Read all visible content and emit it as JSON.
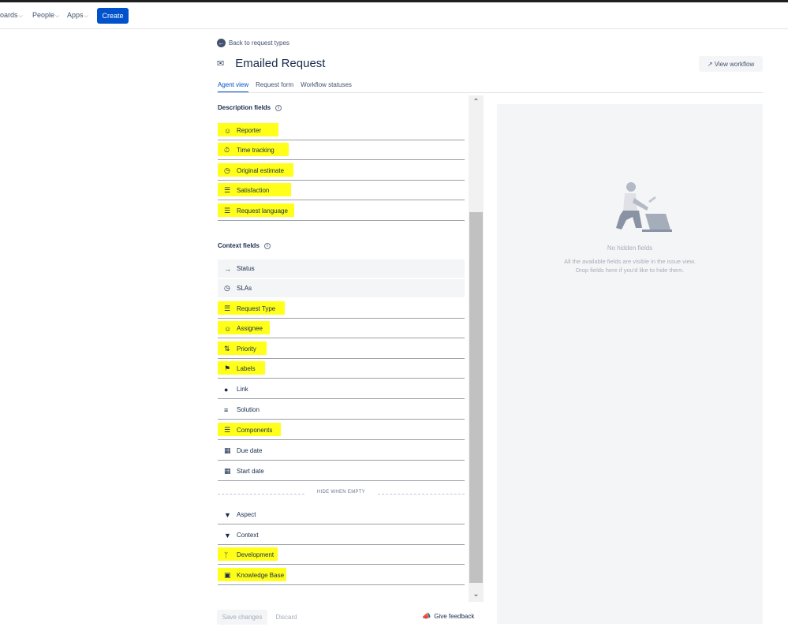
{
  "topnav": {
    "items": [
      {
        "label": "oards"
      },
      {
        "label": "People"
      },
      {
        "label": "Apps"
      }
    ],
    "create_label": "Create"
  },
  "back_link": "Back to request types",
  "page_title": "Emailed Request",
  "view_workflow_label": "View workflow",
  "tabs": [
    {
      "label": "Agent view",
      "active": true
    },
    {
      "label": "Request form",
      "active": false
    },
    {
      "label": "Workflow statuses",
      "active": false
    }
  ],
  "description_fields": {
    "heading": "Description fields",
    "items": [
      {
        "label": "Reporter",
        "icon": "person-circle-icon",
        "highlighted": true
      },
      {
        "label": "Time tracking",
        "icon": "stopwatch-icon",
        "highlighted": true
      },
      {
        "label": "Original estimate",
        "icon": "clock-icon",
        "highlighted": true
      },
      {
        "label": "Satisfaction",
        "icon": "list-icon",
        "highlighted": true
      },
      {
        "label": "Request language",
        "icon": "list-icon",
        "highlighted": true
      }
    ]
  },
  "context_fields": {
    "heading": "Context fields",
    "items": [
      {
        "label": "Status",
        "icon": "arrow-right-icon",
        "highlighted": false
      },
      {
        "label": "SLAs",
        "icon": "clock-icon",
        "highlighted": false
      },
      {
        "label": "Request Type",
        "icon": "list-icon",
        "highlighted": true
      },
      {
        "label": "Assignee",
        "icon": "person-circle-icon",
        "highlighted": true
      },
      {
        "label": "Priority",
        "icon": "sort-arrows-icon",
        "highlighted": true
      },
      {
        "label": "Labels",
        "icon": "tag-icon",
        "highlighted": true
      },
      {
        "label": "Link",
        "icon": "clock-filled-icon",
        "highlighted": false
      },
      {
        "label": "Solution",
        "icon": "text-lines-icon",
        "highlighted": false
      },
      {
        "label": "Components",
        "icon": "list-icon",
        "highlighted": true
      },
      {
        "label": "Due date",
        "icon": "calendar-icon",
        "highlighted": false
      },
      {
        "label": "Start date",
        "icon": "calendar-icon",
        "highlighted": false
      }
    ],
    "hide_when_empty_label": "HIDE WHEN EMPTY",
    "hidden_items": [
      {
        "label": "Aspect",
        "icon": "chevron-circle-icon",
        "highlighted": false
      },
      {
        "label": "Context",
        "icon": "chevron-circle-icon",
        "highlighted": false
      },
      {
        "label": "Development",
        "icon": "branch-icon",
        "highlighted": true
      },
      {
        "label": "Knowledge Base",
        "icon": "book-icon",
        "highlighted": true
      }
    ]
  },
  "footer": {
    "save_label": "Save changes",
    "discard_label": "Discard",
    "feedback_label": "Give feedback"
  },
  "hidden_panel": {
    "title": "No hidden fields",
    "desc_line1": "All the available fields are visible in the issue view.",
    "desc_line2": "Drop fields here if you'd like to hide them."
  },
  "colors": {
    "highlight": "#ffff1a",
    "primary": "#0052cc",
    "text": "#172b4d",
    "panel_bg": "#f4f5f7"
  }
}
